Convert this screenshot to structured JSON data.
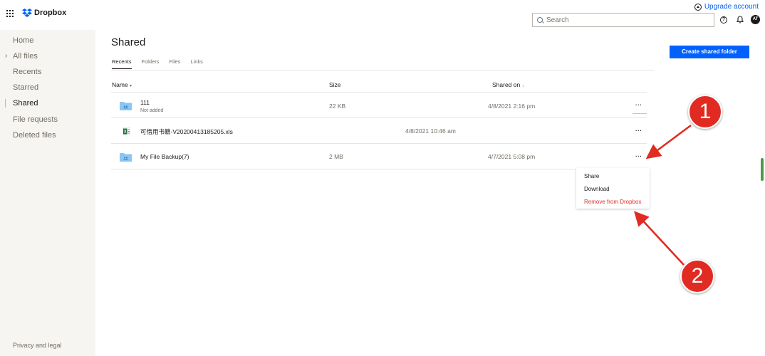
{
  "topbar": {
    "logo_text": "Dropbox",
    "upgrade_label": "Upgrade account",
    "search_placeholder": "Search",
    "help_glyph": "?",
    "avatar_initials": "AT"
  },
  "sidebar": {
    "items": [
      {
        "label": "Home"
      },
      {
        "label": "All files"
      },
      {
        "label": "Recents"
      },
      {
        "label": "Starred"
      },
      {
        "label": "Shared"
      },
      {
        "label": "File requests"
      },
      {
        "label": "Deleted files"
      }
    ],
    "active_item": "Shared",
    "footer": "Privacy and legal"
  },
  "main": {
    "title": "Shared",
    "tabs": [
      {
        "label": "Recents",
        "active": true
      },
      {
        "label": "Folders"
      },
      {
        "label": "Files"
      },
      {
        "label": "Links"
      }
    ],
    "create_button": "Create shared folder",
    "columns": {
      "name": "Name",
      "name_sort": "▾",
      "size": "Size",
      "shared_on": "Shared on",
      "shared_on_sort": "↓"
    },
    "rows": [
      {
        "name": "111",
        "subtitle": "Not added",
        "size": "22 KB",
        "shared_on": "4/8/2021 2:16 pm",
        "icon": "shared-folder-icon",
        "more": "···"
      },
      {
        "name": "可借用书籍-V20200413185205.xls",
        "subtitle": "",
        "size": "4/8/2021 10:46 am",
        "shared_on": "",
        "icon": "excel-file-icon",
        "more": "···"
      },
      {
        "name": "My File Backup(7)",
        "subtitle": "",
        "size": "2 MB",
        "shared_on": "4/7/2021 5:08 pm",
        "icon": "shared-folder-icon",
        "more": "···"
      }
    ],
    "context_menu": [
      {
        "label": "Share"
      },
      {
        "label": "Download"
      },
      {
        "label": "Remove from Dropbox",
        "danger": true
      }
    ]
  },
  "annotations": [
    {
      "label": "1"
    },
    {
      "label": "2"
    }
  ],
  "colors": {
    "accent": "#0061fe",
    "danger": "#e0312b",
    "sidebar_bg": "#f7f5f2",
    "folder": "#8ac6f5",
    "annotation": "#e12b22"
  }
}
